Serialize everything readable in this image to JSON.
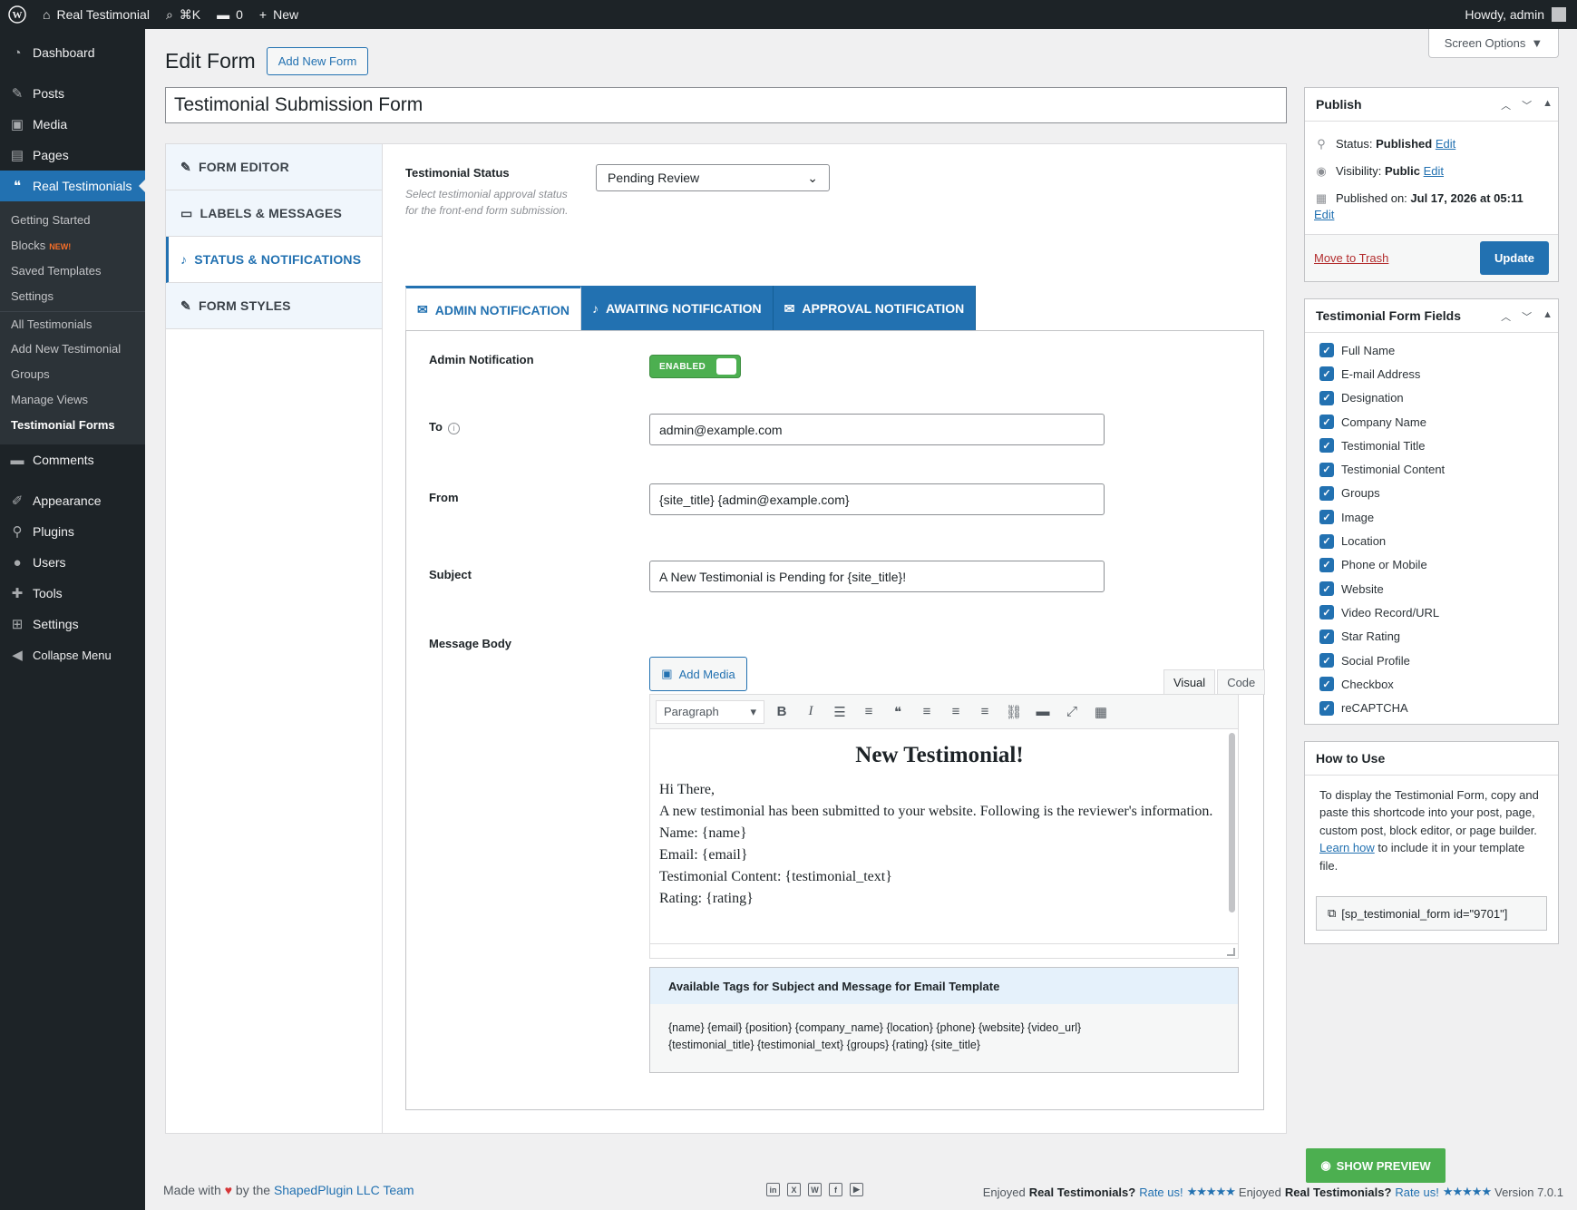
{
  "adminbar": {
    "site_name": "Real Testimonial",
    "search_shortcut": "⌘K",
    "comments_count": "0",
    "new_label": "New",
    "howdy": "Howdy, admin"
  },
  "sidebar": {
    "dashboard": "Dashboard",
    "posts": "Posts",
    "media": "Media",
    "pages": "Pages",
    "real_testimonials": "Real Testimonials",
    "sub": {
      "getting_started": "Getting Started",
      "blocks": "Blocks",
      "blocks_badge": "NEW!",
      "saved_templates": "Saved Templates",
      "settings": "Settings",
      "all_testimonials": "All Testimonials",
      "add_new": "Add New Testimonial",
      "groups": "Groups",
      "manage_views": "Manage Views",
      "testimonial_forms": "Testimonial Forms"
    },
    "comments": "Comments",
    "appearance": "Appearance",
    "plugins": "Plugins",
    "users": "Users",
    "tools": "Tools",
    "settings": "Settings",
    "collapse": "Collapse Menu"
  },
  "header": {
    "screen_options": "Screen Options",
    "title": "Edit Form",
    "add_new": "Add New Form",
    "form_title": "Testimonial Submission Form"
  },
  "vtabs": {
    "form_editor": "FORM EDITOR",
    "labels_messages": "LABELS & MESSAGES",
    "status_notifications": "STATUS & NOTIFICATIONS",
    "form_styles": "FORM STYLES"
  },
  "status": {
    "label": "Testimonial Status",
    "desc": "Select testimonial approval status for the front-end form submission.",
    "selected": "Pending Review"
  },
  "ntabs": {
    "admin": "ADMIN NOTIFICATION",
    "awaiting": "AWAITING NOTIFICATION",
    "approval": "APPROVAL NOTIFICATION"
  },
  "admin": {
    "notif_label": "Admin Notification",
    "toggle": "ENABLED",
    "to_label": "To",
    "to_value": "admin@example.com",
    "from_label": "From",
    "from_value": "{site_title} {admin@example.com}",
    "subject_label": "Subject",
    "subject_value": "A New Testimonial is Pending for {site_title}!",
    "body_label": "Message Body",
    "add_media": "Add Media",
    "visual": "Visual",
    "code": "Code",
    "format": "Paragraph",
    "body": {
      "heading": "New Testimonial!",
      "l1": "Hi There,",
      "l2": "A new testimonial has been submitted to your website. Following is the reviewer's information.",
      "l3": "Name: {name}",
      "l4": "Email: {email}",
      "l5": "Testimonial Content: {testimonial_text}",
      "l6": "Rating: {rating}"
    },
    "tags_title": "Available Tags for Subject and Message for Email Template",
    "tags_line1": "{name} {email} {position} {company_name} {location} {phone} {website} {video_url}",
    "tags_line2": "{testimonial_title} {testimonial_text} {groups} {rating} {site_title}"
  },
  "publish": {
    "title": "Publish",
    "status_label": "Status:",
    "status_value": "Published",
    "visibility_label": "Visibility:",
    "visibility_value": "Public",
    "published_label": "Published on:",
    "published_value": "Jul 17, 2026 at 05:11",
    "edit": "Edit",
    "trash": "Move to Trash",
    "update": "Update"
  },
  "fields_box": {
    "title": "Testimonial Form Fields",
    "items": [
      "Full Name",
      "E-mail Address",
      "Designation",
      "Company Name",
      "Testimonial Title",
      "Testimonial Content",
      "Groups",
      "Image",
      "Location",
      "Phone or Mobile",
      "Website",
      "Video Record/URL",
      "Star Rating",
      "Social Profile",
      "Checkbox",
      "reCAPTCHA"
    ]
  },
  "howto": {
    "title": "How to Use",
    "text1": "To display the Testimonial Form, copy and paste this shortcode into your post, page, custom post, block editor, or page builder.",
    "learn_how": "Learn how",
    "text2": "to include it in your template file.",
    "shortcode": "[sp_testimonial_form id=\"9701\"]"
  },
  "footer": {
    "preview": "SHOW PREVIEW",
    "made_with": "Made with",
    "by_the": "by the",
    "brand": "ShapedPlugin LLC Team",
    "enjoyed": "Enjoyed",
    "product": "Real Testimonials?",
    "rate": "Rate us!",
    "version": "Version 7.0.1"
  }
}
